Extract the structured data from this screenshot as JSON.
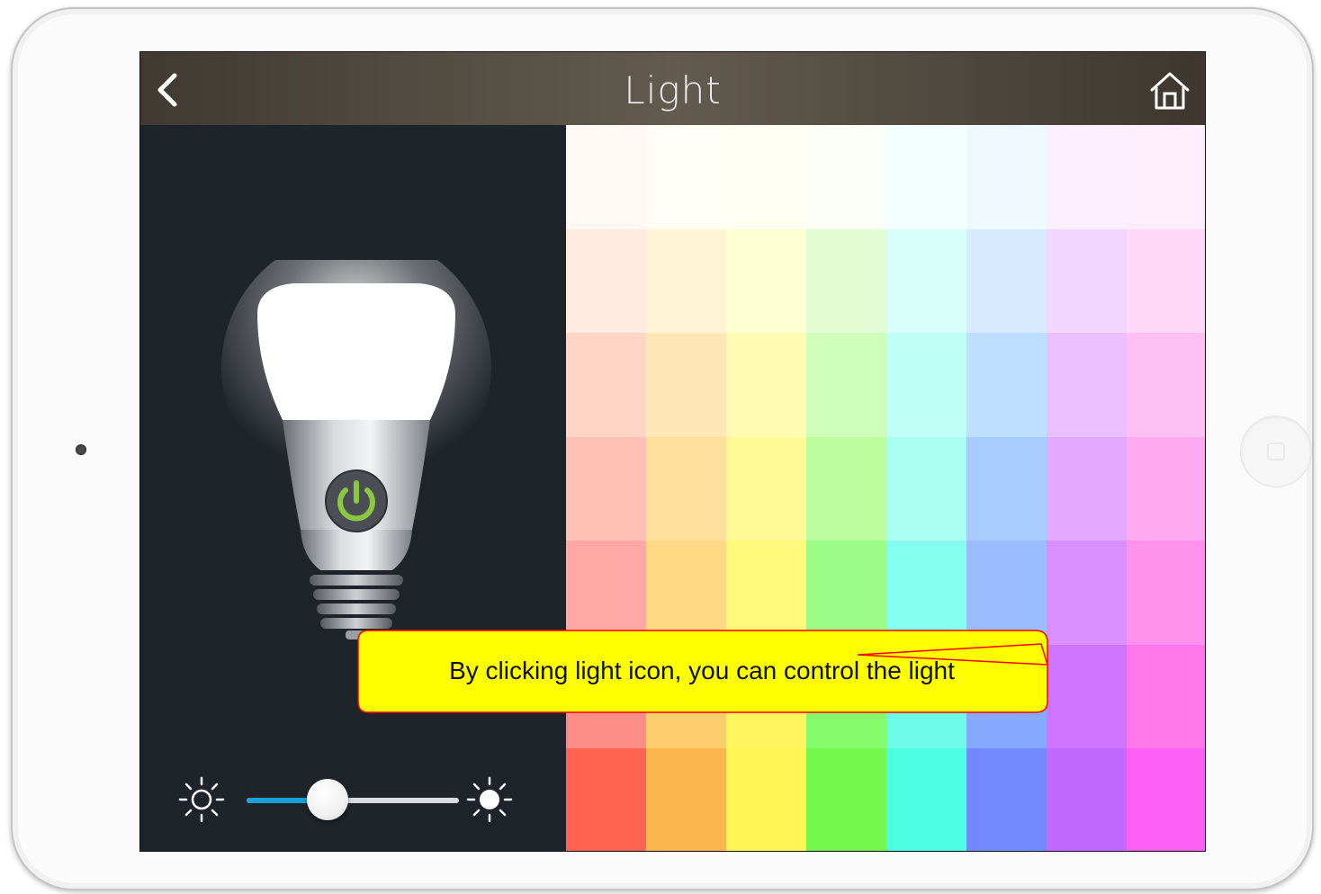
{
  "app": {
    "title": "Light",
    "back_icon": "chevron-left-icon",
    "home_icon": "home-icon"
  },
  "bulb": {
    "power_icon": "power-icon",
    "power_color": "#8dc63f",
    "state": "on"
  },
  "brightness": {
    "min_icon": "sun-outline-icon",
    "max_icon": "sun-filled-icon",
    "value_fraction": 0.38,
    "fill_color": "#1aa1dc"
  },
  "palette": {
    "rows": [
      [
        "#fff8f5",
        "#fffdf6",
        "#fffff6",
        "#fbfff8",
        "#f4fffd",
        "#eef9ff",
        "#fcefff",
        "#ffeefc"
      ],
      [
        "#ffeadf",
        "#fff4d6",
        "#ffffd2",
        "#e2fdd3",
        "#d8fffa",
        "#d6ebff",
        "#f3d6ff",
        "#ffd8f7"
      ],
      [
        "#ffd6c6",
        "#ffe7b6",
        "#fffbb2",
        "#cffdba",
        "#bffff5",
        "#bedfff",
        "#ebc0ff",
        "#ffc0f3"
      ],
      [
        "#ffc1b5",
        "#ffe09a",
        "#fffa96",
        "#bbfd9e",
        "#a8fff2",
        "#a9ccff",
        "#e3a9ff",
        "#ffaaf0"
      ],
      [
        "#ffa8a6",
        "#ffd884",
        "#fff87a",
        "#9cfd88",
        "#84fff0",
        "#9bbcff",
        "#da8fff",
        "#ff92ec"
      ],
      [
        "#ff8d87",
        "#fece6c",
        "#fff65f",
        "#86fb6b",
        "#6cfbe9",
        "#86aaff",
        "#ce74ff",
        "#ff77e9"
      ],
      [
        "#ff6453",
        "#fdb64e",
        "#fff553",
        "#75f84e",
        "#4efee2",
        "#7488fe",
        "#c168fe",
        "#fc5ff3"
      ]
    ]
  },
  "tooltip": {
    "text": "By clicking light icon, you can control the light",
    "fill_color": "#ffff00",
    "border_color": "#ff0000"
  }
}
